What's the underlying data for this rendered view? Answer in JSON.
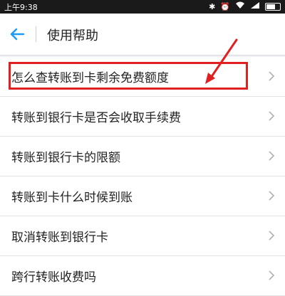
{
  "status_bar": {
    "time": "上午9:38",
    "icons": [
      "bluetooth-icon",
      "alarm-icon",
      "wifi-icon",
      "signal-icon",
      "battery-icon"
    ]
  },
  "header": {
    "title": "使用帮助",
    "back_icon": "back-arrow-icon"
  },
  "help_items": [
    {
      "label": "怎么查转账到卡剩余免费额度"
    },
    {
      "label": "转账到银行卡是否会收取手续费"
    },
    {
      "label": "转账到银行卡的限额"
    },
    {
      "label": "转账到卡什么时候到账"
    },
    {
      "label": "取消转账到银行卡"
    },
    {
      "label": "跨行转账收费吗"
    }
  ],
  "colors": {
    "accent": "#1a9bfc",
    "highlight": "#e02020",
    "background": "#efeff4"
  }
}
